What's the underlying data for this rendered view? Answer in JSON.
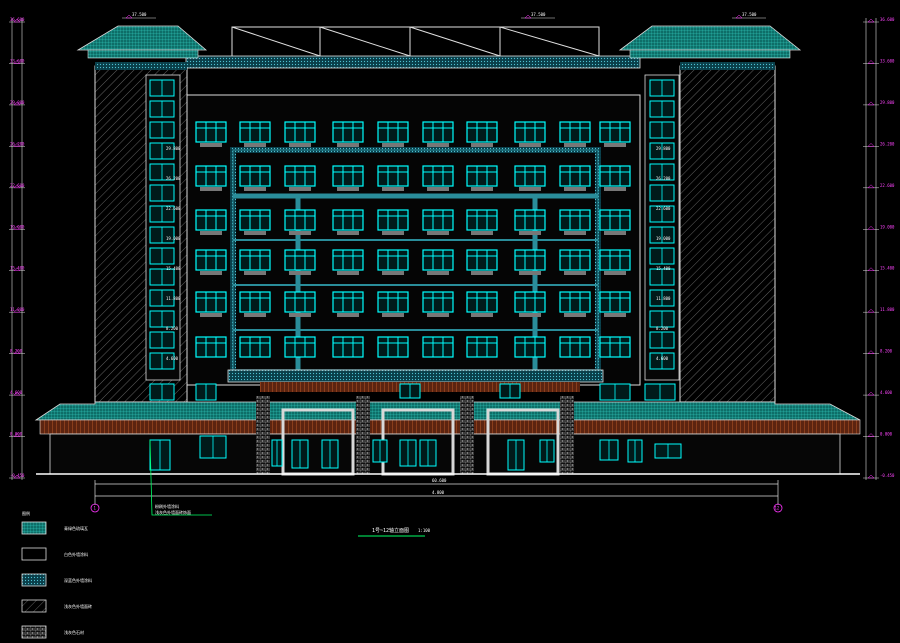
{
  "drawing": {
    "title": "1号~12轴立面图",
    "scale": "1:100",
    "axis_left": "1",
    "axis_right": "12",
    "overall_dim": "60.600",
    "overall_sub": "4.800",
    "callout": [
      "粉刷外墙涂料",
      "浅灰色外墙面砖饰面"
    ]
  },
  "colors": {
    "background": "#000000",
    "window": "#00ffff",
    "roof": "#1aa39a",
    "outline": "#ffffff",
    "hatch": "#8a8a8a",
    "brick": "#b04a1a",
    "dim_mark": "#ff33ff",
    "callout": "#00ff66"
  },
  "legend": {
    "heading": "图例",
    "items": [
      {
        "label": "青绿色琉璃瓦",
        "swatch": "tile"
      },
      {
        "label": "白色外墙涂料",
        "swatch": "white"
      },
      {
        "label": "深蓝色外墙涂料",
        "swatch": "blue"
      },
      {
        "label": "浅灰色外墙面砖",
        "swatch": "hatch"
      },
      {
        "label": "浅灰色石材",
        "swatch": "brick"
      }
    ]
  },
  "elevations": {
    "left": [
      "36.600",
      "33.600",
      "29.800",
      "26.200",
      "22.600",
      "19.000",
      "15.400",
      "11.800",
      "8.200",
      "4.600",
      "0.000",
      "-0.450"
    ],
    "right": [
      "36.600",
      "33.600",
      "29.800",
      "26.200",
      "22.600",
      "19.000",
      "15.400",
      "11.800",
      "8.200",
      "4.600",
      "0.000",
      "-0.450"
    ],
    "top_marks": [
      "37.500",
      "37.500",
      "37.500"
    ],
    "floor_marks": [
      "29.800",
      "26.200",
      "22.600",
      "19.000",
      "15.400",
      "11.800",
      "8.200",
      "4.600"
    ]
  }
}
